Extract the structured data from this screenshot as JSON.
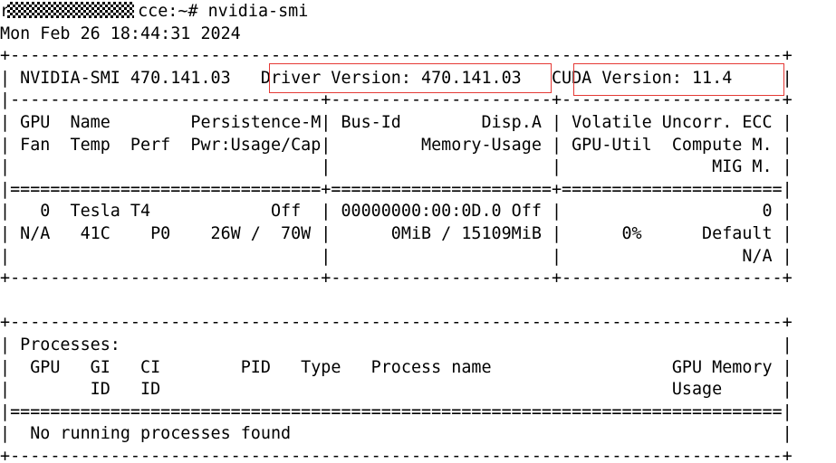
{
  "terminal": {
    "prompt_prefix": "r",
    "prompt_host_suffix": "cce:~# nvidia-smi",
    "timestamp": "Mon Feb 26 18:44:31 2024",
    "lines": [
      "+-----------------------------------------------------------------------------+",
      "| NVIDIA-SMI 470.141.03   Driver Version: 470.141.03   CUDA Version: 11.4     |",
      "|-------------------------------+----------------------+----------------------+",
      "| GPU  Name        Persistence-M| Bus-Id        Disp.A | Volatile Uncorr. ECC |",
      "| Fan  Temp  Perf  Pwr:Usage/Cap|         Memory-Usage | GPU-Util  Compute M. |",
      "|                               |                      |               MIG M. |",
      "|===============================+======================+======================|",
      "|   0  Tesla T4            Off  | 00000000:00:0D.0 Off |                    0 |",
      "| N/A   41C    P0    26W /  70W |      0MiB / 15109MiB |      0%      Default |",
      "|                               |                      |                  N/A |",
      "+-------------------------------+----------------------+----------------------+",
      "",
      "+-----------------------------------------------------------------------------+",
      "| Processes:                                                                  |",
      "|  GPU   GI   CI        PID   Type   Process name                  GPU Memory |",
      "|        ID   ID                                                   Usage      |",
      "|=============================================================================|",
      "|  No running processes found                                                 |",
      "+-----------------------------------------------------------------------------+"
    ]
  },
  "highlights": {
    "color": "#e53935"
  }
}
